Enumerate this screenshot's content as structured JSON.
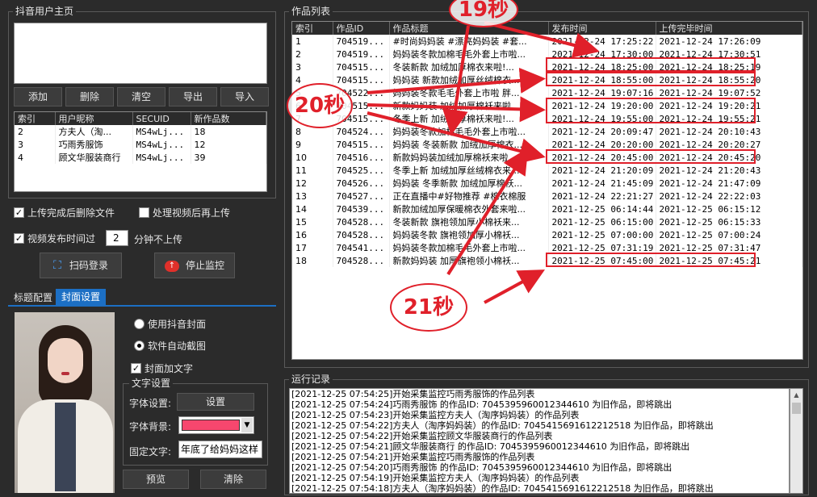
{
  "user_panel": {
    "title": "抖音用户主页",
    "buttons": [
      "添加",
      "删除",
      "清空",
      "导出",
      "导入"
    ],
    "columns": [
      "索引",
      "用户昵称",
      "SECUID",
      "新作品数"
    ],
    "rows": [
      [
        "2",
        "方夫人（淘...",
        "MS4wLj...",
        "18"
      ],
      [
        "3",
        "巧雨秀服饰",
        "MS4wLj...",
        "12"
      ],
      [
        "4",
        "顾文华服装商行",
        "MS4wLj...",
        "39"
      ]
    ]
  },
  "options": {
    "delete_after_upload": "上传完成后删除文件",
    "process_before_upload": "处理视频后再上传",
    "publish_time_prefix": "视频发布时间过",
    "publish_minutes": "2",
    "publish_time_suffix": "分钟不上传",
    "scan_login": "扫码登录",
    "stop_monitor": "停止监控"
  },
  "tabs": [
    "标题配置",
    "封面设置"
  ],
  "cover": {
    "use_douyin_cover": "使用抖音封面",
    "auto_screenshot": "软件自动截图",
    "add_text": "封面加文字",
    "text_settings_title": "文字设置",
    "font_setting_label": "字体设置:",
    "font_setting_button": "设置",
    "font_bg_label": "字体背景:",
    "font_bg_color": "#f7476e",
    "fixed_text_label": "固定文字:",
    "fixed_text_value": "年底了给妈妈这样",
    "preview": "预览",
    "clear": "清除"
  },
  "works": {
    "title": "作品列表",
    "columns": [
      "索引",
      "作品ID",
      "作品标题",
      "发布时间",
      "上传完毕时间"
    ],
    "rows": [
      [
        "1",
        "704519...",
        "#时尚妈妈装 #漂亮妈妈装 #套...",
        "2021-12-24 17:25:22",
        "2021-12-24 17:26:09"
      ],
      [
        "2",
        "704519...",
        "妈妈装冬款加棉毛毛外套上市啦...",
        "2021-12-24 17:30:00",
        "2021-12-24 17:30:51"
      ],
      [
        "3",
        "704515...",
        "冬装新款 加绒加厚棉衣来啦!...",
        "2021-12-24 18:25:00",
        "2021-12-24 18:25:19"
      ],
      [
        "4",
        "704515...",
        "妈妈装 新款加绒加厚丝绒棉衣...",
        "2021-12-24 18:55:00",
        "2021-12-24 18:55:20"
      ],
      [
        "5",
        "704522...",
        "妈妈装冬款毛毛外套上市啦 胖...",
        "2021-12-24 19:07:16",
        "2021-12-24 19:07:52"
      ],
      [
        "6",
        "704515...",
        "新款妈妈装 加绒加厚棉袄来啦...",
        "2021-12-24 19:20:00",
        "2021-12-24 19:20:21"
      ],
      [
        "7",
        "704515...",
        "冬季上新 加绒加厚棉袄来啦!...",
        "2021-12-24 19:55:00",
        "2021-12-24 19:55:21"
      ],
      [
        "8",
        "704524...",
        "妈妈装冬款加棉毛毛外套上市啦...",
        "2021-12-24 20:09:47",
        "2021-12-24 20:10:43"
      ],
      [
        "9",
        "704515...",
        "妈妈装 冬装新款 加绒加厚棉衣...",
        "2021-12-24 20:20:00",
        "2021-12-24 20:20:27"
      ],
      [
        "10",
        "704516...",
        "新款妈妈装加绒加厚棉袄来啦...",
        "2021-12-24 20:45:00",
        "2021-12-24 20:45:20"
      ],
      [
        "11",
        "704525...",
        "冬季上新 加绒加厚丝绒棉衣来...",
        "2021-12-24 21:20:09",
        "2021-12-24 21:20:43"
      ],
      [
        "12",
        "704526...",
        "妈妈装 冬季新款 加绒加厚棉袄...",
        "2021-12-24 21:45:09",
        "2021-12-24 21:47:09"
      ],
      [
        "13",
        "704527...",
        "正在直播中#好物推荐 #棉衣棉服",
        "2021-12-24 22:21:27",
        "2021-12-24 22:22:03"
      ],
      [
        "14",
        "704539...",
        "新款加绒加厚保暖棉衣外套来啦...",
        "2021-12-25 06:14:44",
        "2021-12-25 06:15:12"
      ],
      [
        "15",
        "704528...",
        "冬装新款 旗袍领加厚小棉袄来...",
        "2021-12-25 06:15:00",
        "2021-12-25 06:15:33"
      ],
      [
        "16",
        "704528...",
        "妈妈装冬款 旗袍领加厚小棉袄...",
        "2021-12-25 07:00:00",
        "2021-12-25 07:00:24"
      ],
      [
        "17",
        "704541...",
        "妈妈装冬款加棉毛毛外套上市啦...",
        "2021-12-25 07:31:19",
        "2021-12-25 07:31:47"
      ],
      [
        "18",
        "704528...",
        "新款妈妈装 加厚旗袍领小棉袄...",
        "2021-12-25 07:45:00",
        "2021-12-25 07:45:21"
      ]
    ]
  },
  "annotations": {
    "a19": "19秒",
    "a20": "20秒",
    "a21": "21秒"
  },
  "log": {
    "title": "运行记录",
    "lines": [
      "[2021-12-25 07:54:25]开始采集监控巧雨秀服饰的作品列表",
      "[2021-12-25 07:54:24]巧雨秀服饰 的作品ID: 7045395960012344610   为旧作品，即将跳出",
      "[2021-12-25 07:54:23]开始采集监控方夫人（淘序妈妈装）的作品列表",
      "[2021-12-25 07:54:22]方夫人（淘序妈妈装）的作品ID: 7045415691612212518   为旧作品，即将跳出",
      "[2021-12-25 07:54:22]开始采集监控顾文华服装商行的作品列表",
      "[2021-12-25 07:54:21]顾文华服装商行 的作品ID: 7045395960012344610   为旧作品，即将跳出",
      "[2021-12-25 07:54:21]开始采集监控巧雨秀服饰的作品列表",
      "[2021-12-25 07:54:20]巧雨秀服饰 的作品ID: 7045395960012344610   为旧作品，即将跳出",
      "[2021-12-25 07:54:19]开始采集监控方夫人（淘序妈妈装）的作品列表",
      "[2021-12-25 07:54:18]方夫人（淘序妈妈装）的作品ID: 7045415691612212518   为旧作品，即将跳出"
    ]
  }
}
